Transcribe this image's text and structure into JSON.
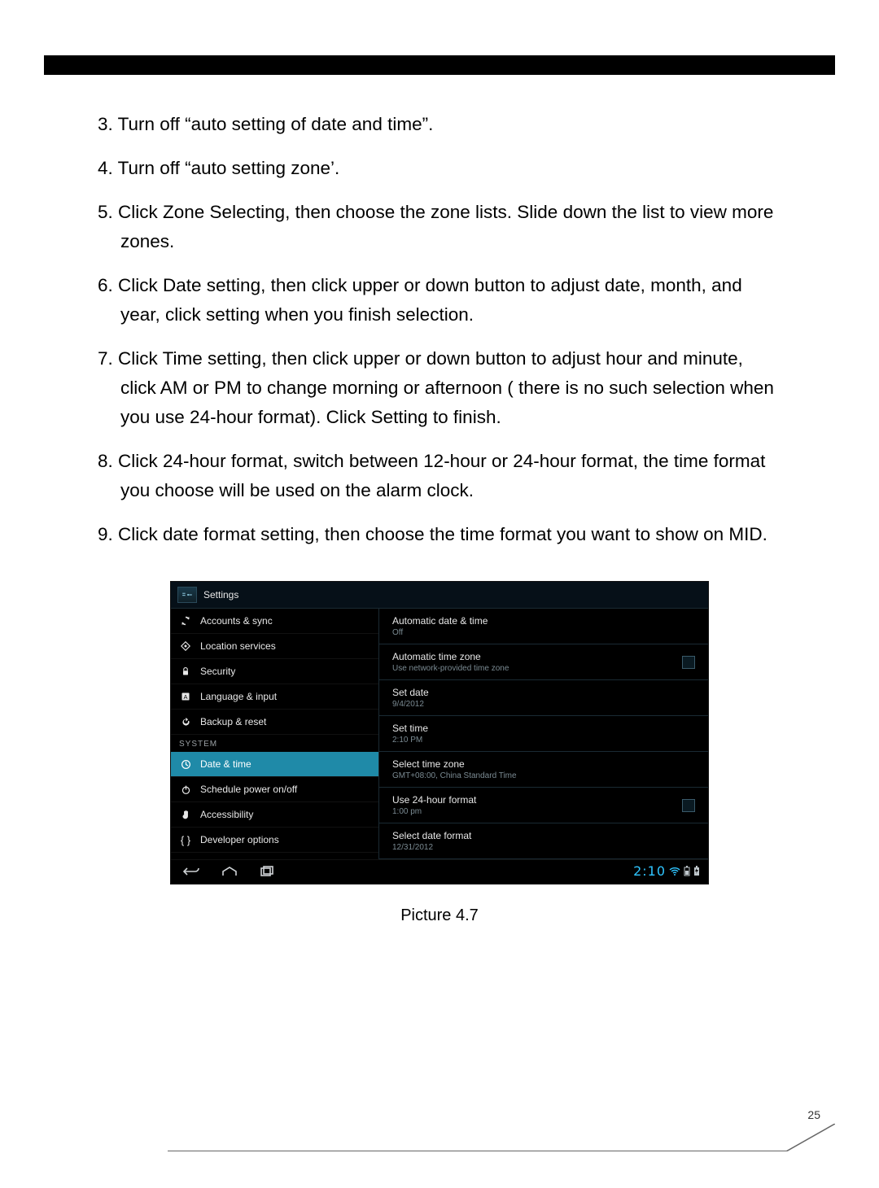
{
  "instructions": {
    "i3": "3. Turn off “auto setting of date and time”.",
    "i4": "4. Turn off “auto setting zone’.",
    "i5": "5. Click Zone Selecting, then choose the zone lists. Slide down the list to view more zones.",
    "i6": "6. Click Date setting, then click upper or down button to adjust date, month, and year, click setting when you finish selection.",
    "i7": "7.  Click Time setting, then click upper or down button to adjust hour and minute, click AM or PM to change morning or afternoon ( there is no such selection when you use 24-hour format). Click Setting to finish.",
    "i8": "8.  Click 24-hour format, switch between 12-hour or 24-hour format, the time format you choose will be used on the alarm clock.",
    "i9": "9.  Click date format setting, then choose the time format you want to show on MID."
  },
  "screenshot": {
    "header_title": "Settings",
    "sidebar": {
      "items": [
        {
          "label": "Accounts & sync"
        },
        {
          "label": "Location services"
        },
        {
          "label": "Security"
        },
        {
          "label": "Language & input"
        },
        {
          "label": "Backup & reset"
        }
      ],
      "section_label": "SYSTEM",
      "system_items": [
        {
          "label": "Date & time"
        },
        {
          "label": "Schedule power on/off"
        },
        {
          "label": "Accessibility"
        },
        {
          "label": "Developer options"
        }
      ]
    },
    "detail": {
      "rows": [
        {
          "title": "Automatic date & time",
          "sub": "Off"
        },
        {
          "title": "Automatic time zone",
          "sub": "Use network-provided time zone",
          "checkbox": true
        },
        {
          "title": "Set date",
          "sub": "9/4/2012"
        },
        {
          "title": "Set time",
          "sub": "2:10 PM"
        },
        {
          "title": "Select time zone",
          "sub": "GMT+08:00, China Standard Time"
        },
        {
          "title": "Use 24-hour format",
          "sub": "1:00 pm",
          "checkbox": true
        },
        {
          "title": "Select date format",
          "sub": "12/31/2012"
        }
      ]
    },
    "navbar_time": "2:10"
  },
  "caption": "Picture 4.7",
  "page_number": "25"
}
